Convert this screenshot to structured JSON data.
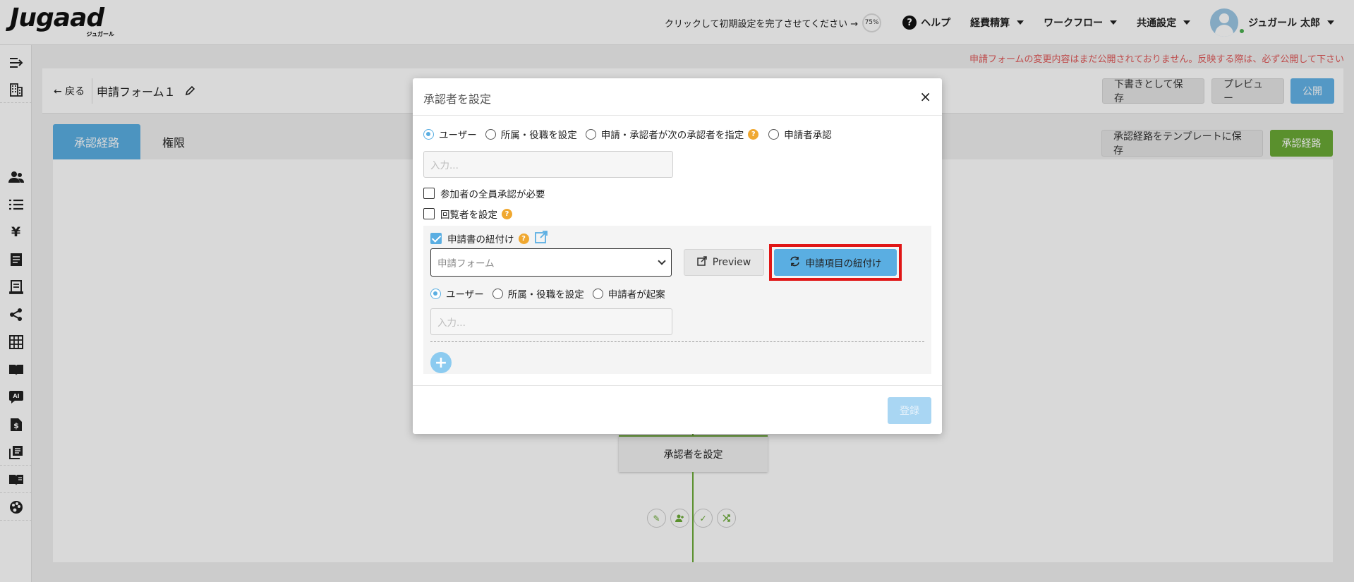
{
  "app": {
    "logo_text": "Jugaad",
    "logo_sub": "ジュガール"
  },
  "header": {
    "setup_text": "クリックして初期設定を完了させてください →",
    "setup_progress": "75%",
    "help_label": "ヘルプ",
    "menu_expenses": "経費精算",
    "menu_workflow": "ワークフロー",
    "menu_common": "共通設定",
    "user_name": "ジュガール 太郎"
  },
  "sidebar": {
    "icons": [
      "expand-menu-icon",
      "building-icon",
      "users-icon",
      "list-icon",
      "yen-icon",
      "document-icon",
      "receipt-icon",
      "share-icon",
      "grid-icon",
      "book-open-icon",
      "ai-chat-icon",
      "file-dollar-icon",
      "library-icon",
      "manual-icon",
      "palette-icon"
    ]
  },
  "warning_text": "申請フォームの変更内容はまだ公開されておりません。反映する際は、必ず公開して下さい",
  "topbar": {
    "back_label": "← 戻る",
    "form_title": "申請フォーム１",
    "save_draft_label": "下書きとして保存",
    "preview_label": "プレビュー",
    "publish_label": "公開"
  },
  "tabs": {
    "route_label": "承認経路",
    "permission_label": "権限"
  },
  "toolbar": {
    "save_template_label": "承認経路をテンプレートに保存",
    "route_button_label": "承認経路"
  },
  "flow": {
    "node_label": "承認者を設定"
  },
  "modal": {
    "title": "承認者を設定",
    "approver_types": [
      "ユーザー",
      "所属・役職を設定",
      "申請・承認者が次の承認者を指定",
      "申請者承認"
    ],
    "approver_selected": "ユーザー",
    "input_placeholder": "入力...",
    "all_approval_label": "参加者の全員承認が必要",
    "all_approval_checked": false,
    "viewer_label": "回覧者を設定",
    "viewer_checked": false,
    "link_label": "申請書の紐付け",
    "link_checked": true,
    "form_select_value": "申請フォーム",
    "preview_button_label": "Preview",
    "link_items_button_label": "申請項目の紐付け",
    "sub_types": [
      "ユーザー",
      "所属・役職を設定",
      "申請者が起案"
    ],
    "sub_selected": "ユーザー",
    "sub_input_placeholder": "入力...",
    "register_label": "登録"
  },
  "colors": {
    "accent_blue": "#5aaee2",
    "accent_green": "#6aaa35",
    "warning_red": "#e05a5a",
    "highlight_red": "#e01616"
  }
}
